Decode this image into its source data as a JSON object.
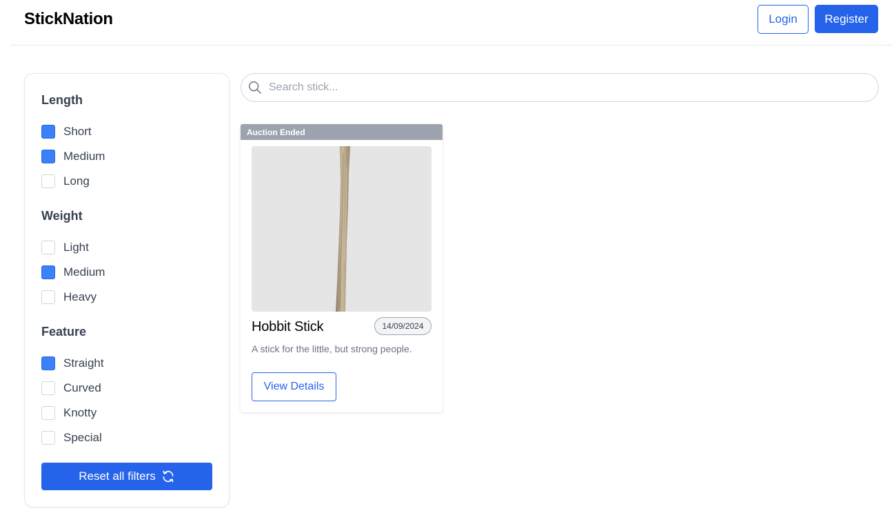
{
  "header": {
    "brand": "StickNation",
    "login_label": "Login",
    "register_label": "Register"
  },
  "colors": {
    "accent": "#2563eb",
    "checkbox_checked": "#3b82f6",
    "ribbon": "#9ca3af"
  },
  "filters": {
    "groups": [
      {
        "title": "Length",
        "options": [
          {
            "label": "Short",
            "checked": true
          },
          {
            "label": "Medium",
            "checked": true
          },
          {
            "label": "Long",
            "checked": false
          }
        ]
      },
      {
        "title": "Weight",
        "options": [
          {
            "label": "Light",
            "checked": false
          },
          {
            "label": "Medium",
            "checked": true
          },
          {
            "label": "Heavy",
            "checked": false
          }
        ]
      },
      {
        "title": "Feature",
        "options": [
          {
            "label": "Straight",
            "checked": true
          },
          {
            "label": "Curved",
            "checked": false
          },
          {
            "label": "Knotty",
            "checked": false
          },
          {
            "label": "Special",
            "checked": false
          }
        ]
      }
    ],
    "reset_label": "Reset all filters",
    "reset_icon": "refresh-icon"
  },
  "search": {
    "placeholder": "Search stick...",
    "value": "",
    "icon": "search-icon"
  },
  "products": [
    {
      "status": "Auction Ended",
      "title": "Hobbit Stick",
      "date": "14/09/2024",
      "description": "A stick for the little, but strong people.",
      "button_label": "View Details"
    }
  ]
}
